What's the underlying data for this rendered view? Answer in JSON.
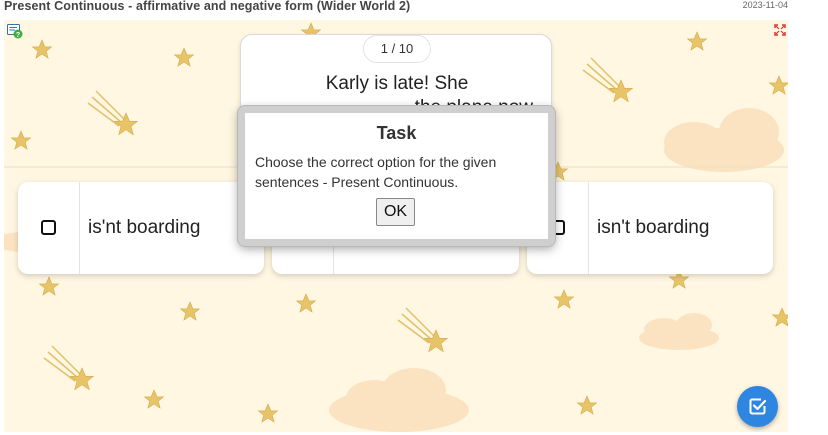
{
  "header": {
    "title": "Present Continuous - affirmative and negative form (Wider World 2)",
    "date": "2023-11-04"
  },
  "icons": {
    "help": "help-question-icon",
    "fullscreen": "fullscreen-icon",
    "submit": "check-square-icon",
    "checkbox": "checkbox-icon"
  },
  "prompt": {
    "counter": "1 / 10",
    "line1": "Karly is late! She",
    "line2": "the plane now"
  },
  "options": [
    {
      "label": "is'nt boarding",
      "checked": false
    },
    {
      "label": "",
      "checked": false
    },
    {
      "label": "isn't boarding",
      "checked": false
    }
  ],
  "modal": {
    "title": "Task",
    "text": "Choose the correct option for the given sentences - Present Continuous.",
    "ok_label": "OK"
  },
  "colors": {
    "background": "#fff7e2",
    "star": "#e8c468",
    "cloud": "#fbe3c2",
    "accent": "#2f86e0"
  }
}
